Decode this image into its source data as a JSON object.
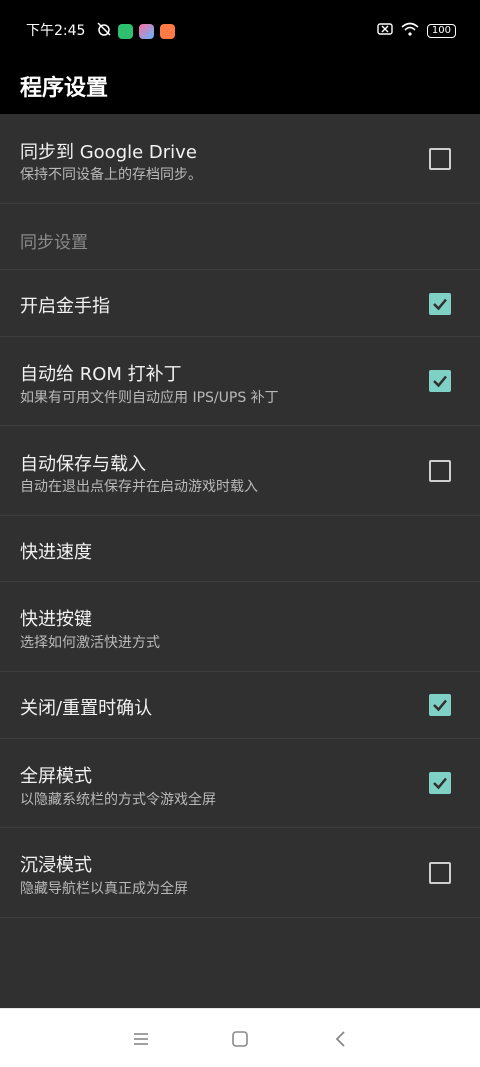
{
  "status_bar": {
    "time": "下午2:45",
    "battery": "100",
    "icons": [
      "alarm-off-icon",
      "app-icon-green",
      "app-icon-gallery",
      "app-icon-orange",
      "sim-off-icon",
      "wifi-icon",
      "battery-icon"
    ]
  },
  "appbar": {
    "title": "程序设置"
  },
  "settings": [
    {
      "title": "同步到 Google Drive",
      "subtitle": "保持不同设备上的存档同步。",
      "checked": false
    },
    {
      "category": "同步设置"
    },
    {
      "title": "开启金手指",
      "checked": true
    },
    {
      "title": "自动给 ROM 打补丁",
      "subtitle": "如果有可用文件则自动应用 IPS/UPS 补丁",
      "checked": true
    },
    {
      "title": "自动保存与载入",
      "subtitle": "自动在退出点保存并在启动游戏时载入",
      "checked": false
    },
    {
      "title": "快进速度"
    },
    {
      "title": "快进按键",
      "subtitle": "选择如何激活快进方式"
    },
    {
      "title": "关闭/重置时确认",
      "checked": true
    },
    {
      "title": "全屏模式",
      "subtitle": "以隐藏系统栏的方式令游戏全屏",
      "checked": true
    },
    {
      "title": "沉浸模式",
      "subtitle": "隐藏导航栏以真正成为全屏",
      "checked": false
    }
  ],
  "nav_bar": {
    "icons": [
      "menu-icon",
      "home-icon",
      "back-icon"
    ]
  },
  "colors": {
    "accent": "#7fd1c6",
    "background": "#303030",
    "appbar": "#000000"
  }
}
